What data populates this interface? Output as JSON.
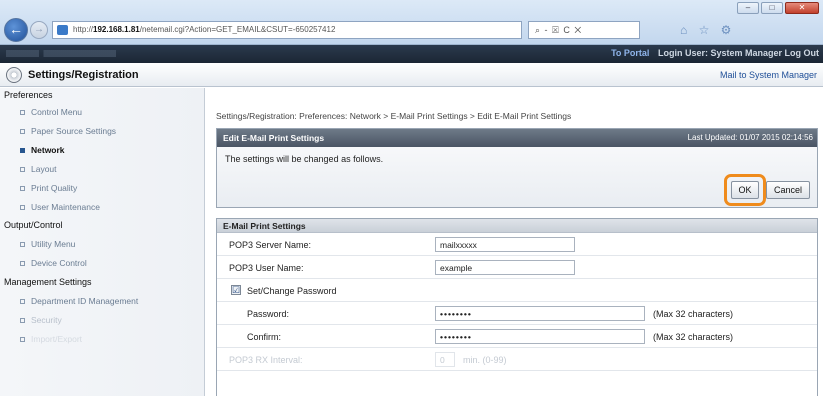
{
  "browser": {
    "url_prefix": "http://",
    "url_host": "192.168.1.81",
    "url_rest": "/netemail.cgi?Action=GET_EMAIL&CSUT=-650257412",
    "addr_tools": "⌕ - ☒ C ✕",
    "right_icons": "⌂ ☆ ⚙",
    "win_min": "–",
    "win_max": "□",
    "win_close": "✕"
  },
  "topbar": {
    "portal_link": "To Portal",
    "login_user": "Login User: System Manager",
    "logout": "Log Out"
  },
  "header": {
    "title": "Settings/Registration",
    "mail_link": "Mail to System Manager"
  },
  "sidebar": {
    "preferences_title": "Preferences",
    "preferences_items": [
      "Control Menu",
      "Paper Source Settings",
      "Network",
      "Layout",
      "Print Quality",
      "User Maintenance"
    ],
    "output_title": "Output/Control",
    "output_items": [
      "Utility Menu",
      "Device Control"
    ],
    "management_title": "Management Settings",
    "management_items": [
      "Department ID Management",
      "Security",
      "Import/Export"
    ]
  },
  "main": {
    "breadcrumb": "Settings/Registration: Preferences: Network > E-Mail Print Settings > Edit E-Mail Print Settings",
    "edit_box": {
      "title": "Edit E-Mail Print Settings",
      "last_updated": "Last Updated: 01/07 2015 02:14:56",
      "message": "The settings will be changed as follows.",
      "ok_label": "OK",
      "cancel_label": "Cancel"
    },
    "settings_box": {
      "title": "E-Mail Print Settings",
      "pop3_server_label": "POP3 Server Name:",
      "pop3_server_value": "mailxxxxx",
      "pop3_user_label": "POP3 User Name:",
      "pop3_user_value": "example",
      "set_password_label": "Set/Change Password",
      "set_password_checked": "☑",
      "password_label": "Password:",
      "password_value": "••••••••",
      "password_hint": "(Max 32 characters)",
      "confirm_label": "Confirm:",
      "confirm_value": "••••••••",
      "confirm_hint": "(Max 32 characters)",
      "rx_interval_label": "POP3 RX Interval:",
      "rx_interval_value": "0",
      "rx_interval_hint": "min. (0-99)"
    }
  }
}
